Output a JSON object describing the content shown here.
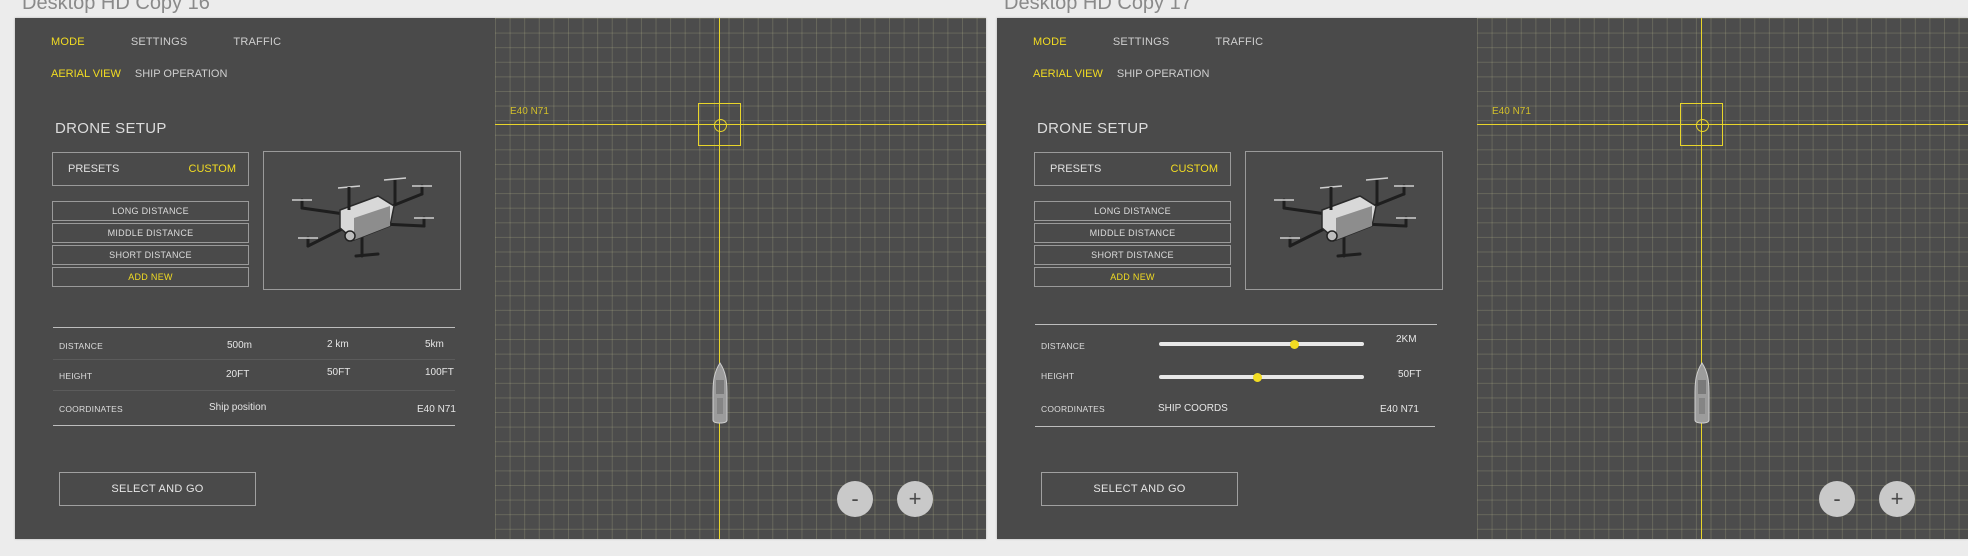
{
  "boards": [
    {
      "title": "Desktop HD Copy 16",
      "nav": {
        "mode": "MODE",
        "settings": "SETTINGS",
        "traffic": "TRAFFIC"
      },
      "subnav": {
        "aerial": "AERIAL VIEW",
        "ship": "SHIP OPERATION"
      },
      "section_title": "DRONE SETUP",
      "presets": {
        "label": "PRESETS",
        "value": "CUSTOM"
      },
      "preset_items": [
        "LONG DISTANCE",
        "MIDDLE DISTANCE",
        "SHORT DISTANCE",
        "ADD NEW"
      ],
      "params": {
        "distance": {
          "label": "DISTANCE",
          "options": [
            "500m",
            "2 km",
            "5km"
          ]
        },
        "height": {
          "label": "HEIGHT",
          "options": [
            "20FT",
            "50FT",
            "100FT"
          ]
        },
        "coordinates": {
          "label": "COORDINATES",
          "option": "Ship position",
          "value": "E40 N71"
        }
      },
      "select_button": "SELECT AND GO",
      "map": {
        "coord_label": "E40 N71",
        "zoom_out": "-",
        "zoom_in": "+"
      }
    },
    {
      "title": "Desktop HD Copy 17",
      "nav": {
        "mode": "MODE",
        "settings": "SETTINGS",
        "traffic": "TRAFFIC"
      },
      "subnav": {
        "aerial": "AERIAL VIEW",
        "ship": "SHIP OPERATION"
      },
      "section_title": "DRONE SETUP",
      "presets": {
        "label": "PRESETS",
        "value": "CUSTOM"
      },
      "preset_items": [
        "LONG DISTANCE",
        "MIDDLE DISTANCE",
        "SHORT DISTANCE",
        "ADD NEW"
      ],
      "params": {
        "distance": {
          "label": "DISTANCE",
          "value": "2KM",
          "level": 0.66
        },
        "height": {
          "label": "HEIGHT",
          "value": "50FT",
          "level": 0.48
        },
        "coordinates": {
          "label": "COORDINATES",
          "option": "SHIP COORDS",
          "value": "E40 N71"
        }
      },
      "select_button": "SELECT AND GO",
      "map": {
        "coord_label": "E40 N71",
        "zoom_out": "-",
        "zoom_in": "+"
      }
    }
  ],
  "colors": {
    "accent": "#f2dc22",
    "panel": "#4a4a4a",
    "text": "#dcdcdc"
  }
}
